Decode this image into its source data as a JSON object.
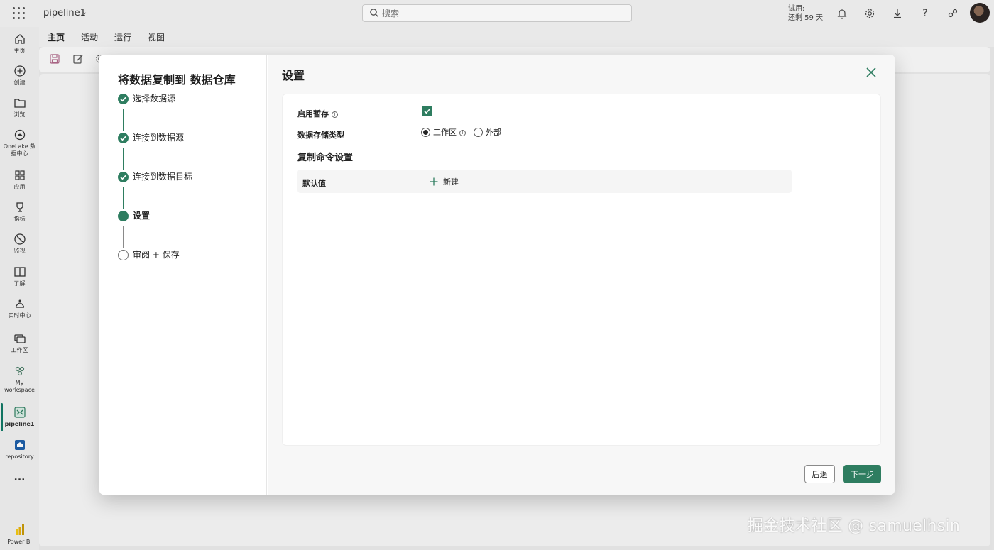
{
  "app": {
    "name": "pipeline1"
  },
  "search": {
    "placeholder": "搜索"
  },
  "trial": {
    "line1": "试用:",
    "line2": "还剩 59 天"
  },
  "ribbon": {
    "tabs": [
      "主页",
      "活动",
      "运行",
      "视图"
    ]
  },
  "rail": {
    "items": [
      {
        "label": "主页",
        "icon": "home-icon"
      },
      {
        "label": "创建",
        "icon": "plus-circle-icon"
      },
      {
        "label": "浏览",
        "icon": "folder-icon"
      },
      {
        "label": "OneLake 数据中心",
        "icon": "onelake-icon"
      },
      {
        "label": "应用",
        "icon": "apps-icon"
      },
      {
        "label": "指标",
        "icon": "trophy-icon"
      },
      {
        "label": "监视",
        "icon": "monitor-icon"
      },
      {
        "label": "了解",
        "icon": "book-icon"
      },
      {
        "label": "实时中心",
        "icon": "realtime-icon"
      },
      {
        "label": "工作区",
        "icon": "workspace-icon"
      },
      {
        "label": "My workspace",
        "icon": "my-workspace-icon"
      },
      {
        "label": "pipeline1",
        "icon": "pipeline-icon"
      },
      {
        "label": "repository",
        "icon": "repository-icon"
      },
      {
        "label": "...",
        "icon": "more-icon"
      },
      {
        "label": "Power BI",
        "icon": "powerbi-icon"
      }
    ]
  },
  "wizard": {
    "title": "将数据复制到 数据仓库",
    "steps": [
      {
        "label": "选择数据源",
        "state": "done"
      },
      {
        "label": "连接到数据源",
        "state": "done"
      },
      {
        "label": "连接到数据目标",
        "state": "done"
      },
      {
        "label": "设置",
        "state": "current"
      },
      {
        "label": "审阅 + 保存",
        "state": "todo"
      }
    ]
  },
  "settings": {
    "title": "设置",
    "enable_staging_label": "启用暂存",
    "enable_staging": true,
    "storage_type_label": "数据存储类型",
    "storage_options": [
      "工作区",
      "外部"
    ],
    "storage_selected": "工作区",
    "copy_command_heading": "复制命令设置",
    "defaults_label": "默认值",
    "new_label": "新建"
  },
  "footer": {
    "back_label": "后退",
    "next_label": "下一步"
  },
  "watermark": "掘金技术社区 @ samuelhsin",
  "colors": {
    "accent": "#2e7d60",
    "tab_underline": "#117865"
  }
}
